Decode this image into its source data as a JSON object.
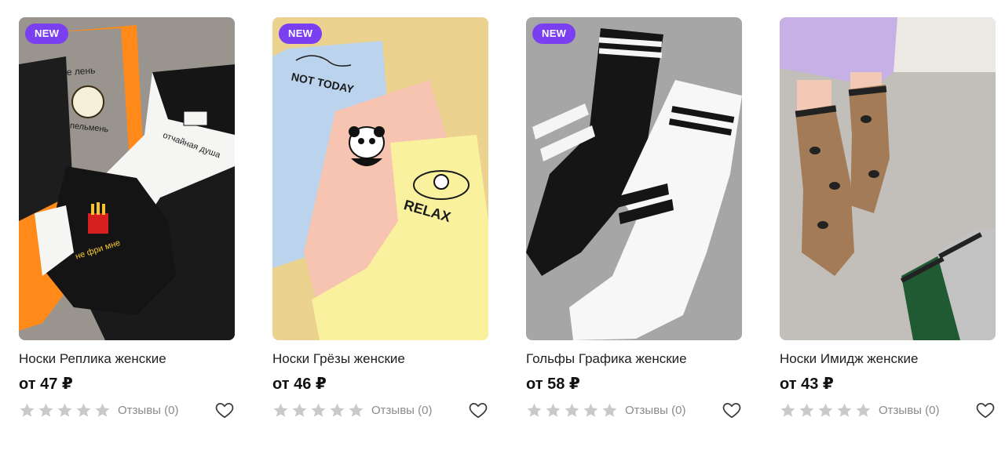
{
  "badge_label": "NEW",
  "products": [
    {
      "title": "Носки Реплика женские",
      "price": "от 47 ₽",
      "rating": 0,
      "reviews": "Отзывы (0)",
      "is_new": true,
      "image_texts": [
        "мне лень",
        "я пельмень",
        "отчайная душа",
        "не фри мне"
      ]
    },
    {
      "title": "Носки Грёзы женские",
      "price": "от 46 ₽",
      "rating": 0,
      "reviews": "Отзывы (0)",
      "is_new": true,
      "image_texts": [
        "NOT TODAY",
        "RELAX"
      ]
    },
    {
      "title": "Гольфы Графика женские",
      "price": "от 58 ₽",
      "rating": 0,
      "reviews": "Отзывы (0)",
      "is_new": true,
      "image_texts": []
    },
    {
      "title": "Носки Имидж женские",
      "price": "от 43 ₽",
      "rating": 0,
      "reviews": "Отзывы (0)",
      "is_new": false,
      "image_texts": []
    }
  ],
  "colors": {
    "badge": "#7b3ff2",
    "star_empty": "#c9c9c9",
    "reviews_text": "#8a8a8a"
  },
  "icons": {
    "favorite": "heart-outline-icon",
    "rating": "star-icon"
  }
}
